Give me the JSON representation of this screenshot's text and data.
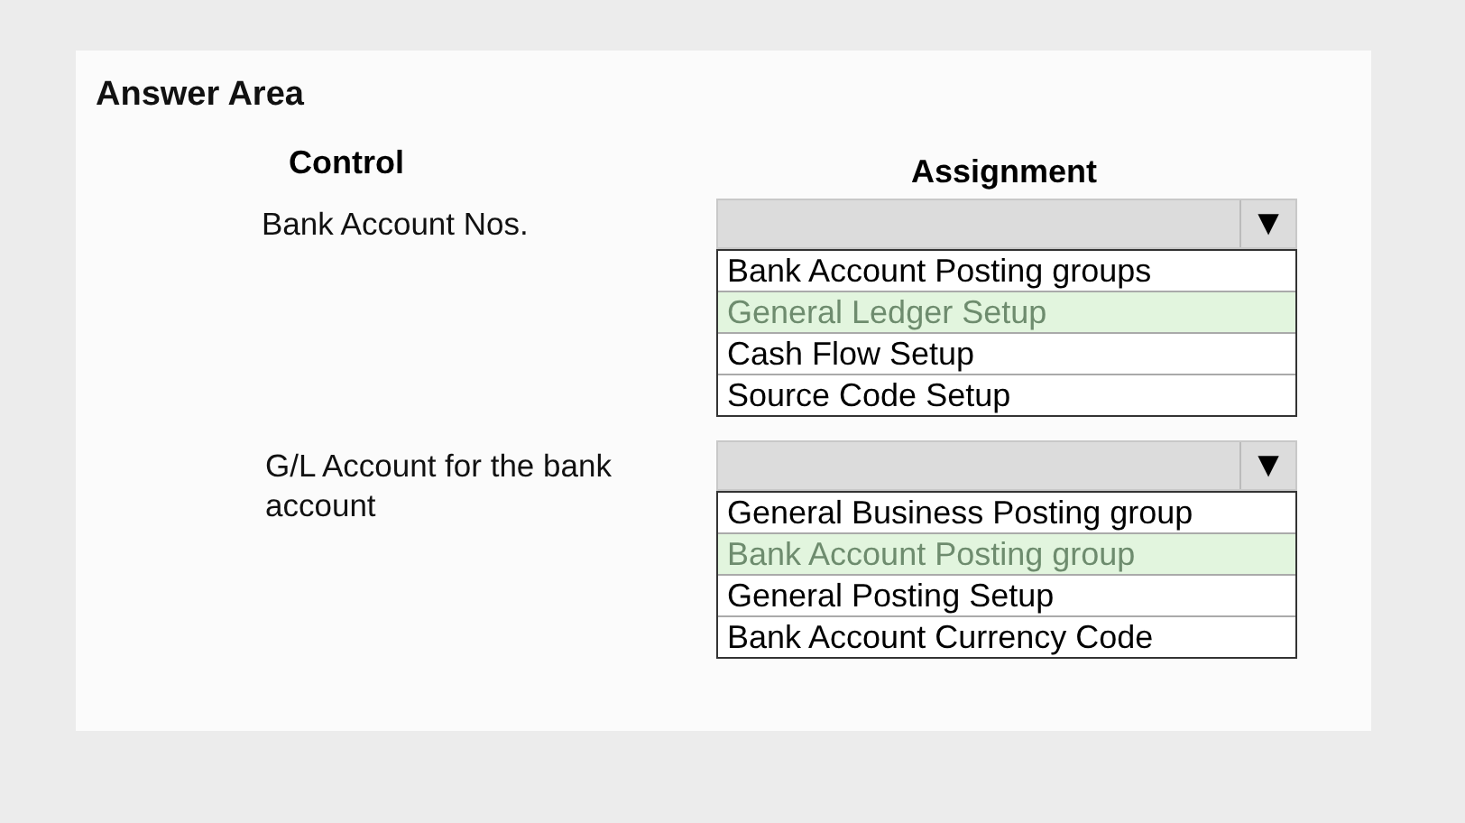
{
  "title": "Answer Area",
  "headers": {
    "control": "Control",
    "assignment": "Assignment"
  },
  "rows": [
    {
      "control": "Bank Account Nos.",
      "arrow": "▼",
      "options": [
        {
          "label": "Bank Account Posting groups",
          "selected": false
        },
        {
          "label": "General Ledger Setup",
          "selected": true
        },
        {
          "label": "Cash Flow Setup",
          "selected": false
        },
        {
          "label": "Source Code Setup",
          "selected": false
        }
      ]
    },
    {
      "control": "G/L Account for the bank account",
      "arrow": "▼",
      "options": [
        {
          "label": "General Business Posting group",
          "selected": false
        },
        {
          "label": "Bank Account Posting group",
          "selected": true
        },
        {
          "label": "General Posting Setup",
          "selected": false
        },
        {
          "label": "Bank Account Currency Code",
          "selected": false
        }
      ]
    }
  ]
}
